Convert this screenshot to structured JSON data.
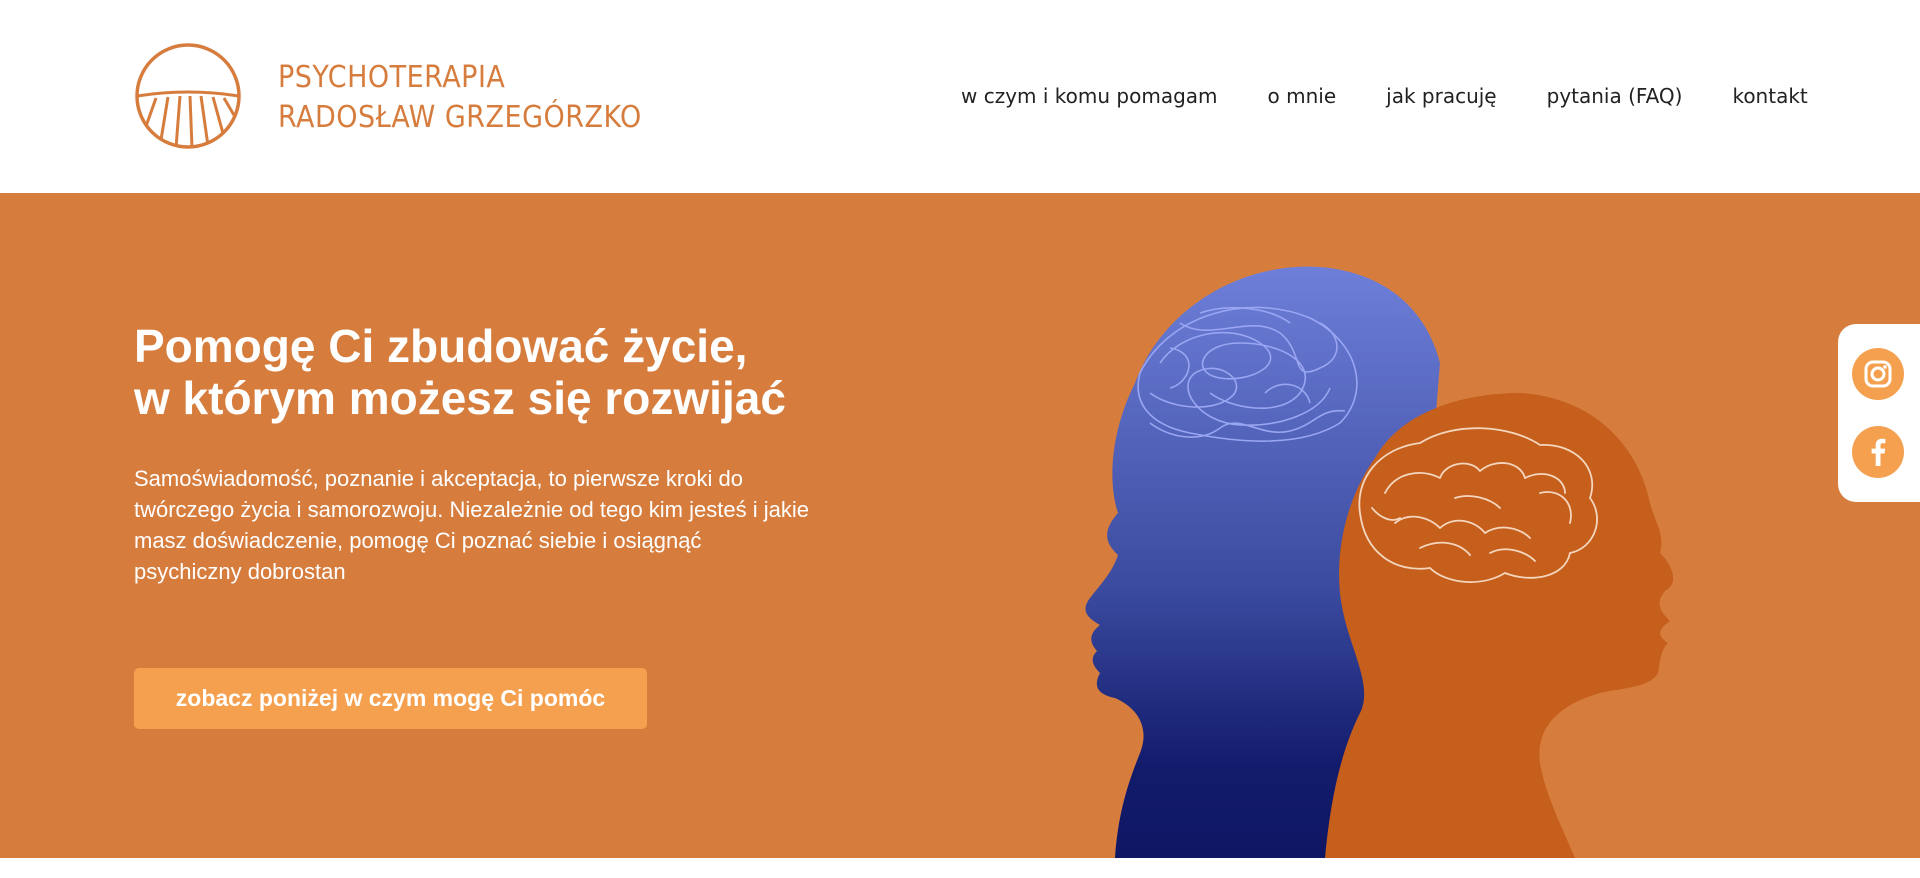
{
  "brand": {
    "line1": "PSYCHOTERAPIA",
    "line2": "RADOSŁAW GRZEGÓRZKO",
    "color": "#d67d3e",
    "logo_icon": "sun-horizon-logo-icon"
  },
  "nav": {
    "items": [
      {
        "label": "w czym i komu pomagam"
      },
      {
        "label": "o mnie"
      },
      {
        "label": "jak pracuję"
      },
      {
        "label": "pytania (FAQ)"
      },
      {
        "label": "kontakt"
      }
    ]
  },
  "hero": {
    "title_line1": "Pomogę Ci zbudować życie,",
    "title_line2": "w którym możesz się rozwijać",
    "description": "Samoświadomość, poznanie i akceptacja, to pierwsze kroki do twórczego życia i samorozwoju. Niezależnie od tego kim jesteś i jakie masz doświadczenie, pomogę Ci poznać siebie i osiągnąć psychiczny dobrostan",
    "cta_label": "zobacz poniżej w czym mogę Ci pomóc",
    "background_color": "#d67d3e",
    "cta_color": "#f4a04e",
    "illustration": "two-heads-brain-illustration"
  },
  "social": {
    "items": [
      {
        "name": "instagram-icon"
      },
      {
        "name": "facebook-icon"
      }
    ],
    "color": "#f4a04e"
  }
}
